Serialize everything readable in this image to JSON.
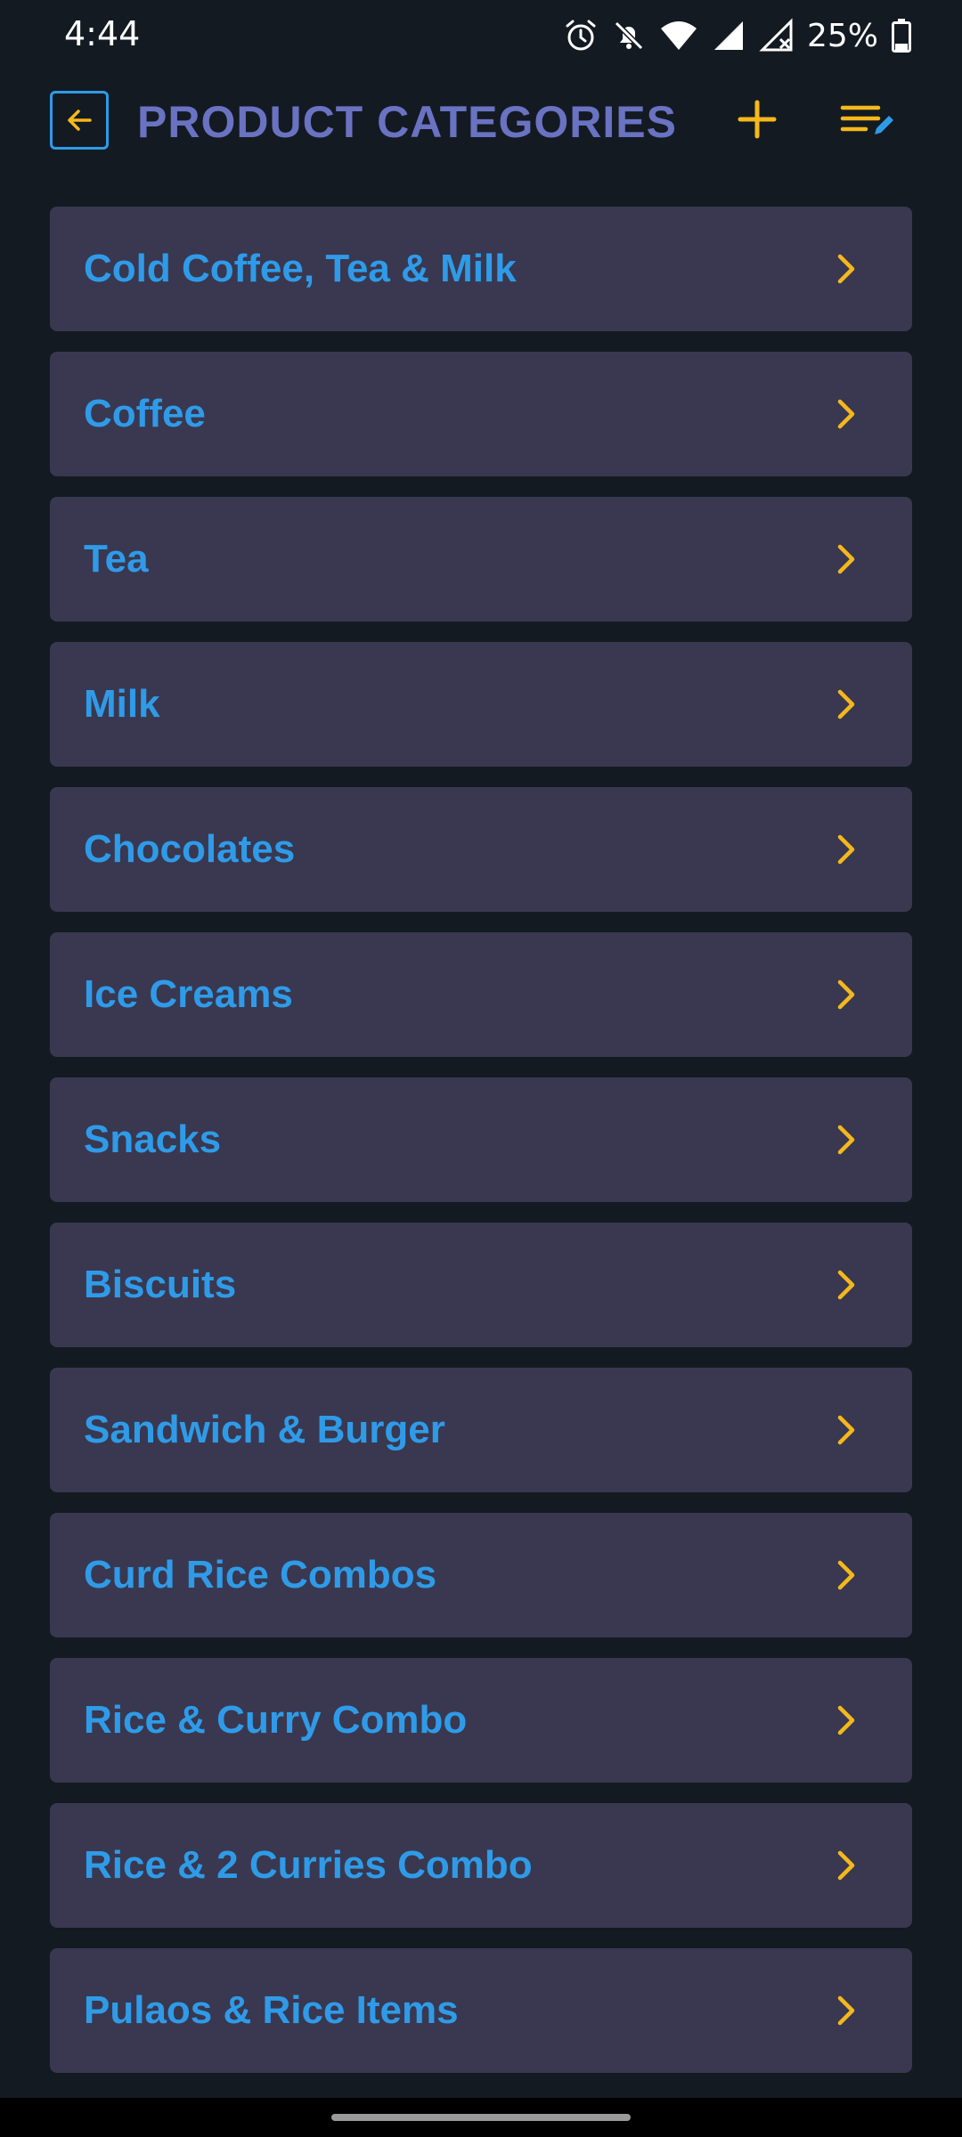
{
  "status_bar": {
    "time": "4:44",
    "battery_percent": "25%",
    "icons": [
      "alarm-icon",
      "notifications-off-icon",
      "wifi-icon",
      "signal-icon",
      "signal-no-service-icon",
      "battery-icon"
    ]
  },
  "header": {
    "title": "PRODUCT CATEGORIES",
    "back_icon": "arrow-left-icon",
    "add_icon": "plus-icon",
    "reorder_icon": "edit-list-icon"
  },
  "colors": {
    "background": "#141a22",
    "card": "#393850",
    "label": "#2f9be8",
    "accent": "#f5b81c",
    "title": "#6a72c2"
  },
  "categories": [
    {
      "label": "Cold Coffee, Tea & Milk"
    },
    {
      "label": "Coffee"
    },
    {
      "label": "Tea"
    },
    {
      "label": "Milk"
    },
    {
      "label": "Chocolates"
    },
    {
      "label": "Ice Creams"
    },
    {
      "label": "Snacks"
    },
    {
      "label": "Biscuits"
    },
    {
      "label": "Sandwich & Burger"
    },
    {
      "label": "Curd Rice Combos"
    },
    {
      "label": "Rice & Curry Combo"
    },
    {
      "label": "Rice & 2 Curries Combo"
    },
    {
      "label": "Pulaos & Rice Items"
    }
  ]
}
